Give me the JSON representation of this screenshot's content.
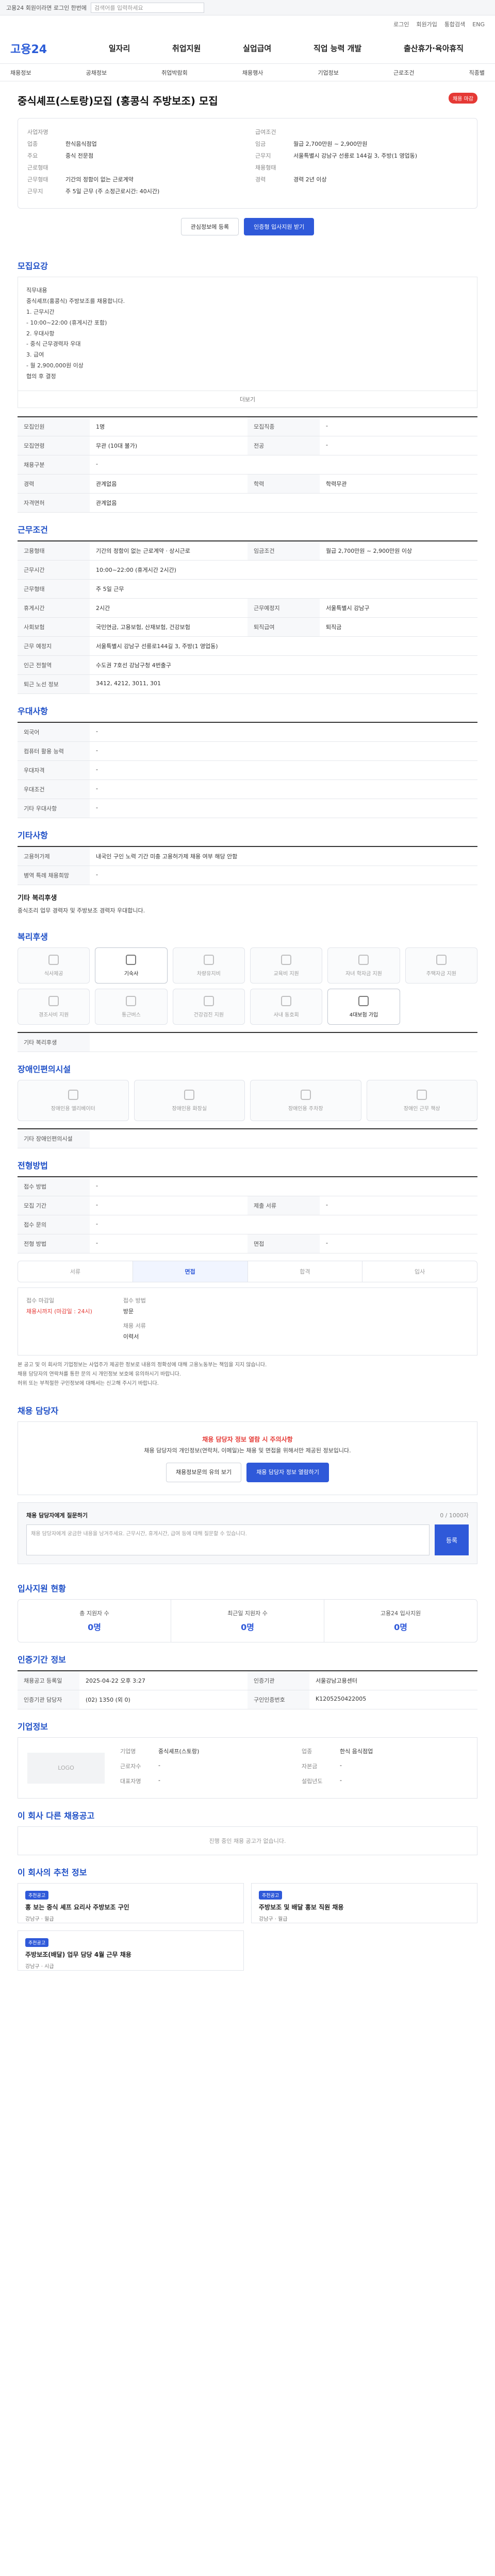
{
  "top": {
    "notice": "고용24 회원이라면 로그인 한번에",
    "search_placeholder": "검색어를 입력하세요"
  },
  "util": [
    "로그인",
    "회원가입",
    "통합검색",
    "ENG"
  ],
  "logo": "고용24",
  "gnb": [
    "일자리",
    "취업지원",
    "실업급여",
    "직업 능력 개발",
    "출산휴가·육아휴직"
  ],
  "lnb": [
    "채용정보",
    "공채정보",
    "취업박람회",
    "채용행사",
    "기업정보",
    "근로조건",
    "직종별"
  ],
  "job": {
    "title": "중식셰프(스토랑)모집 (홍콩식 주방보조) 모집",
    "badge": "채용 마감"
  },
  "company": {
    "left": [
      {
        "k": "사업자명",
        "v": ""
      },
      {
        "k": "업종",
        "v": "한식음식점업"
      },
      {
        "k": "주요",
        "v": "중식 전문점"
      },
      {
        "k": "근로형태",
        "v": ""
      },
      {
        "k": "근무형태",
        "v": "기간의 정함이 없는 근로계약"
      },
      {
        "k": "근무지",
        "v": "주 5일 근무 (주 소정근로시간: 40시간)"
      }
    ],
    "right": [
      {
        "k": "급여조건",
        "v": ""
      },
      {
        "k": "임금",
        "v": "월급 2,700만원 ~ 2,900만원"
      },
      {
        "k": "근무지",
        "v": "서울특별시 강남구 선릉로 144길 3, 주방(1 영업동)"
      },
      {
        "k": "채용형태",
        "v": ""
      },
      {
        "k": "경력",
        "v": "경력 2년 이상"
      }
    ]
  },
  "buttons": {
    "scrap": "관심정보에 등록",
    "share": "인증형 입사지원 받기"
  },
  "sections": {
    "recruit": "모집요강",
    "work": "근무조건",
    "welfare": "우대사항",
    "other": "기타사항",
    "benefit": "복리후생",
    "disability": "장애인편의시설",
    "process": "전형방법",
    "qa": "채용 담당자",
    "applicants": "입사지원 현황",
    "info": "인증기간 정보",
    "corp": "기업정보",
    "related": "이 회사 다른 채용공고",
    "similar": "이 회사의 추천 정보"
  },
  "recruit_text": "직무내용\n중식셰프(홍콩식) 주방보조를 채용합니다.\n1. 근무시간\n- 10:00~22:00 (휴게시간 포함)\n2. 우대사항\n- 중식 근무경력자 우대\n3. 급여\n- 월 2,900,000원 이상\n협의 후 결정",
  "more_label": "더보기",
  "recruit_rows": [
    {
      "k": "모집인원",
      "v": "1명",
      "k2": "모집직종",
      "v2": "-"
    },
    {
      "k": "모집연령",
      "v": "무관 (10대 불가)",
      "k2": "전공",
      "v2": "-"
    },
    {
      "k": "채용구분",
      "v": "-",
      "k2": "",
      "v2": ""
    },
    {
      "k": "경력",
      "v": "관계없음",
      "k2": "학력",
      "v2": "학력무관"
    },
    {
      "k": "자격면허",
      "v": "관계없음",
      "k2": "",
      "v2": ""
    }
  ],
  "work_rows": [
    {
      "k": "고용형태",
      "v": "기간의 정함이 없는 근로계약 · 상시근로",
      "k2": "임금조건",
      "v2": "월급 2,700만원 ~ 2,900만원 이상"
    },
    {
      "k": "근무시간",
      "v": "10:00~22:00 (휴게시간 2시간)",
      "k2": "",
      "v2": ""
    },
    {
      "k": "근무형태",
      "v": "주 5일 근무",
      "k2": "",
      "v2": ""
    },
    {
      "k": "휴게시간",
      "v": "2시간",
      "k2": "근무예정지",
      "v2": "서울특별시 강남구"
    },
    {
      "k": "사회보험",
      "v": "국민연금, 고용보험, 산재보험, 건강보험",
      "k2": "퇴직급여",
      "v2": "퇴직금"
    },
    {
      "k": "근무 예정지",
      "v": "서울특별시 강남구 선릉로144길 3, 주방(1 영업동)",
      "k2": "",
      "v2": ""
    },
    {
      "k": "인근 전철역",
      "v": "수도권 7호선 강남구청 4번출구",
      "k2": "",
      "v2": ""
    },
    {
      "k": "퇴근 노선 정보",
      "v": "3412, 4212, 3011, 301",
      "k2": "",
      "v2": ""
    }
  ],
  "welfare_rows": [
    {
      "k": "외국어",
      "v": "-"
    },
    {
      "k": "컴퓨터 활용 능력",
      "v": "-"
    },
    {
      "k": "우대자격",
      "v": "-"
    },
    {
      "k": "우대조건",
      "v": "-"
    },
    {
      "k": "기타 우대사항",
      "v": "-"
    }
  ],
  "other_rows": [
    {
      "k": "고용허가제",
      "v": "내국인 구인 노력 기간 미충 고용허가제 채용 여부 해당 안함"
    },
    {
      "k": "병역 특례 채용희망",
      "v": "-"
    }
  ],
  "other_note_h": "기타 복리후생",
  "other_note": "중식조리 업무 경력자 및 주방보조 경력자 우대합니다.",
  "benefits": [
    {
      "label": "식사제공",
      "on": false
    },
    {
      "label": "기숙사",
      "on": true
    },
    {
      "label": "차량유지비",
      "on": false
    },
    {
      "label": "교육비 지원",
      "on": false
    },
    {
      "label": "자녀 학자금 지원",
      "on": false
    },
    {
      "label": "주택자금 지원",
      "on": false
    },
    {
      "label": "경조사비 지원",
      "on": false
    },
    {
      "label": "통근버스",
      "on": false
    },
    {
      "label": "건강검진 지원",
      "on": false
    },
    {
      "label": "사내 동호회",
      "on": false
    },
    {
      "label": "4대보험 가입",
      "on": true
    }
  ],
  "benefit_other_k": "기타 복리후생",
  "disability_items": [
    {
      "label": "장애인용 엘리베이터"
    },
    {
      "label": "장애인용 화장실"
    },
    {
      "label": "장애인용 주차장"
    },
    {
      "label": "장애인 근무 책상"
    }
  ],
  "disability_note_k": "기타 장애인편의시설",
  "process_rows": [
    {
      "k": "접수 방법",
      "v": "-"
    },
    {
      "k": "모집 기간",
      "v": "-",
      "k2": "제출 서류",
      "v2": "-"
    },
    {
      "k": "접수 문의",
      "v": "-",
      "k2": "",
      "v2": ""
    },
    {
      "k": "전형 방법",
      "v": "-",
      "k2": "면접",
      "v2": "-"
    }
  ],
  "steps": [
    {
      "label": "서류",
      "on": false
    },
    {
      "label": "면접",
      "on": true
    },
    {
      "label": "합격",
      "on": false
    },
    {
      "label": "입사",
      "on": false
    }
  ],
  "apply": {
    "a1": "접수 마감일",
    "a1v": "채용시까지 (마감일 : 24시)",
    "a2": "접수 방법",
    "a2v": "방문",
    "a3": "채용 서류",
    "a3v": "이력서"
  },
  "notes": [
    "본 공고 및 이 회사의 기업정보는 사업주가 제공한 정보로 내용의 정확성에 대해 고용노동부는 책임을 지지 않습니다.",
    "채용 담당자의 연락처를 통한 문의 시 개인정보 보호에 유의하시기 바랍니다.",
    "허위 또는 부적절한 구인정보에 대해서는 신고해 주시기 바랍니다."
  ],
  "qa_alert": {
    "title": "채용 담당자 정보 열람 시 주의사항",
    "body": "채용 담당자의 개인정보(연락처, 이메일)는 채용 및 면접을 위해서만 제공된 정보입니다.",
    "btn1": "채용정보문의 유의 보기",
    "btn2": "채용 담당자 정보 열람하기"
  },
  "qa": {
    "title": "채용 담당자에게 질문하기",
    "counter": "0 / 1000자",
    "placeholder": "채용 담당자에게 궁금한 내용을 남겨주세요. 근무시간, 휴게시간, 급여 등에 대해 질문할 수 있습니다.",
    "send": "등록"
  },
  "applicants": [
    {
      "n": "총 지원자 수",
      "c": "0명"
    },
    {
      "n": "최근일 지원자 수",
      "c": "0명"
    },
    {
      "n": "고용24 입사지원",
      "c": "0명"
    }
  ],
  "info_rows": [
    {
      "k": "채용공고 등록일",
      "v": "2025-04-22 오후 3:27",
      "k2": "인증기관",
      "v2": "서울강남고용센터"
    },
    {
      "k": "인증기관 담당자",
      "v": "(02) 1350 (외 0)",
      "k2": "구인인증번호",
      "v2": "K1205250422005"
    }
  ],
  "corp_logo": "LOGO",
  "corp_info": [
    {
      "k": "기업명",
      "v": "중식셰프(스토랑)"
    },
    {
      "k": "업종",
      "v": "한식 음식점업"
    },
    {
      "k": "근로자수",
      "v": "-"
    },
    {
      "k": "자본금",
      "v": "-"
    },
    {
      "k": "대표자명",
      "v": "-"
    },
    {
      "k": "설립년도",
      "v": "-"
    }
  ],
  "related_empty": "진행 중인 채용 공고가 없습니다.",
  "cards": [
    {
      "b": "추천공고",
      "t": "홍 보는 중식 셰프 요리사 주방보조 구인",
      "c": "강남구 · 월급"
    },
    {
      "b": "추천공고",
      "t": "주방보조 및 배달 홍보 직원 채용",
      "c": "강남구 · 월급"
    },
    {
      "b": "추천공고",
      "t": "주방보조(배달) 업무 담당 4월 근무 채용",
      "c": "강남구 · 시급"
    }
  ]
}
